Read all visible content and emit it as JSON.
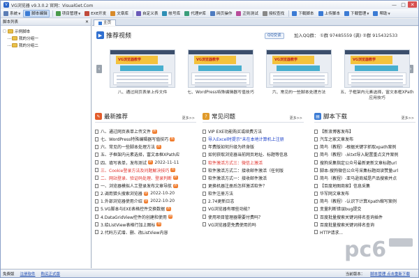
{
  "window": {
    "title": "VG浏览器 v9.3.0.2   官网：VisualGet.Com",
    "controls": [
      "—",
      "□",
      "✕"
    ]
  },
  "toolbar": {
    "items": [
      {
        "label": "系统",
        "dd": true,
        "color": "#5b7db5"
      },
      {
        "label": "脚本编辑",
        "dd": false,
        "color": "#3b7bd4",
        "active": true
      },
      {
        "label": "项目管理",
        "dd": true,
        "color": "#4a9a4a"
      },
      {
        "label": "EXE开发",
        "dd": false,
        "color": "#c04a3a"
      },
      {
        "label": "文章库",
        "dd": false,
        "color": "#d88a2a"
      },
      {
        "label": "自定义表",
        "dd": false,
        "color": "#6a5ab8"
      },
      {
        "label": "帐号库",
        "dd": false,
        "color": "#2e8fb5"
      },
      {
        "label": "代理IP库",
        "dd": false,
        "color": "#3a9e7a"
      },
      {
        "label": "网页操作",
        "dd": false,
        "color": "#4f7cc0"
      },
      {
        "label": "正则测试",
        "dd": false,
        "color": "#b84c9a"
      },
      {
        "label": "授权查找",
        "dd": false,
        "color": "#888888"
      },
      {
        "label": "下载脚本",
        "dd": false,
        "color": "#3b7bd4"
      },
      {
        "label": "上传脚本",
        "dd": false,
        "color": "#3b7bd4"
      },
      {
        "label": "下载管理",
        "dd": true,
        "color": "#3b7bd4"
      },
      {
        "label": "帮助",
        "dd": true,
        "color": "#3b7bd4"
      }
    ]
  },
  "sidebar": {
    "header": "脚本列表",
    "close": "✕",
    "tree": [
      {
        "label": "示例脚本",
        "expander": "□",
        "child": false
      },
      {
        "label": "我的分组一",
        "expander": "",
        "child": true
      },
      {
        "label": "我的分组二",
        "expander": "",
        "child": true
      }
    ]
  },
  "tabs": [
    {
      "label": "主页"
    }
  ],
  "videos": {
    "title": "推荐视频",
    "qq_chat": "QQ交谈",
    "qq_info": "加入QQ群：  ①群 97485559 (满)  ②群 915432533",
    "items": [
      {
        "caption": "八、通过网页表单上传文件",
        "banner": "VG浏览器教学"
      },
      {
        "caption": "七、WordPress特殊编辑器写值技巧",
        "banner": "VG浏览器教学"
      },
      {
        "caption": "六、常见的一些脚本处理方法",
        "banner": "VG浏览器教学"
      },
      {
        "caption": "五、子框架内元素选择，富文本框XPath应用技巧",
        "banner": "VG浏览器教学"
      }
    ]
  },
  "columns": [
    {
      "title": "最新推荐",
      "more": "更多>>",
      "icon_color": "#e35c2a",
      "items": [
        {
          "text": "八、通过网页表单上传文件",
          "hot": true,
          "color": "#222"
        },
        {
          "text": "七、WordPress特殊编辑器写值技巧",
          "hot": true,
          "color": "#222"
        },
        {
          "text": "六、常见的一些脚本处理方法",
          "hot": true,
          "color": "#222"
        },
        {
          "text": "五、子框架内元素选择，富文本框XPath应",
          "hot": false,
          "color": "#222"
        },
        {
          "text": "四、填写表单，发布测试",
          "hot": true,
          "date": "2022-11-11",
          "color": "#222"
        },
        {
          "text": "三、Cookie登录方法及问题解决技巧",
          "hot": true,
          "color": "#e0302a"
        },
        {
          "text": "二、网站登录、验证码处理、登录判断",
          "hot": true,
          "color": "#e0302a"
        },
        {
          "text": "一、浏览器模拟人工登录发布文章导航",
          "hot": true,
          "color": "#222"
        },
        {
          "text": "2.调用猎头搜索浏览器",
          "hot": true,
          "date": "2022-10-20",
          "color": "#222"
        },
        {
          "text": "1.外部浏览器使用介绍",
          "hot": true,
          "date": "2022-10-20",
          "color": "#222"
        },
        {
          "text": "5.VG脚本与EXE表格控件交换数据",
          "hot": true,
          "color": "#222"
        },
        {
          "text": "4.DataGridView控件的创建和使用",
          "hot": true,
          "color": "#222"
        },
        {
          "text": "3.给ListView表格行加上图标",
          "hot": true,
          "color": "#222"
        },
        {
          "text": "2.代码方式增、删、改ListView内容",
          "hot": false,
          "color": "#222"
        }
      ]
    },
    {
      "title": "常见问题",
      "more": "更多>>",
      "icon_color": "#e09a2a",
      "items": [
        {
          "text": "VIP EXE功能购买或续费方法",
          "color": "#222"
        },
        {
          "text": "导入Excel时提示\"未在本地计算机上注册",
          "color": "#1a3ec8"
        },
        {
          "text": "年费版如何升级为终身版",
          "color": "#222"
        },
        {
          "text": "如何获取浏览器当前网页地址、标题等信息",
          "color": "#222"
        },
        {
          "text": "软件激活方式三：微信上激活",
          "color": "#e0302a"
        },
        {
          "text": "软件激活方式二：接收邮件激活（任何版",
          "color": "#222"
        },
        {
          "text": "软件激活方式一：接收邮件激活",
          "color": "#222"
        },
        {
          "text": "更换机器注册后怎样激活软件？",
          "color": "#222"
        },
        {
          "text": "软件注册方法",
          "color": "#222"
        },
        {
          "text": "2.74更新日志",
          "color": "#222"
        },
        {
          "text": "VG浏览器有哪些功能？",
          "color": "#222"
        },
        {
          "text": "使用项目管理器需要付费吗？",
          "color": "#222"
        },
        {
          "text": "VG浏览器是免费使用的吗",
          "color": "#222"
        }
      ]
    },
    {
      "title": "脚本下载",
      "more": "更多>>",
      "icon_color": "#3b7bd4",
      "items": [
        {
          "text": "【新浪博客发布】"
        },
        {
          "text": "汽车之家文章发布"
        },
        {
          "text": "简鸟（教程）-根据关键字抓取xpath案例"
        },
        {
          "text": "简鸟（教程）-从txt导入配置重点文件案例"
        },
        {
          "text": "搜狗采集指定公众号最新更新文章标题url"
        },
        {
          "text": "脚本-搜狗微信公众号采集标题阅读赞量url"
        },
        {
          "text": "简鸟（教程）-亚马逊商城是产品搜索并点"
        },
        {
          "text": "【百度地图商家】信息采集"
        },
        {
          "text": "华军网文章发布"
        },
        {
          "text": "简鸟（教程）-认识下计算Xpath缩写案例"
        },
        {
          "text": "变量利断错误bug提交"
        },
        {
          "text": "百度批量搜索关键词排名查询插件"
        },
        {
          "text": "百度批量搜索关键词排名查询"
        },
        {
          "text": "HTTP请求..."
        }
      ]
    }
  ],
  "status": {
    "left": [
      "免费版",
      "注册软件",
      "购买正式版"
    ],
    "right": [
      "当前版本：",
      "脚本管理  点击重新下载"
    ]
  },
  "watermark": {
    "text": "pc6",
    "sub": "下载站"
  }
}
